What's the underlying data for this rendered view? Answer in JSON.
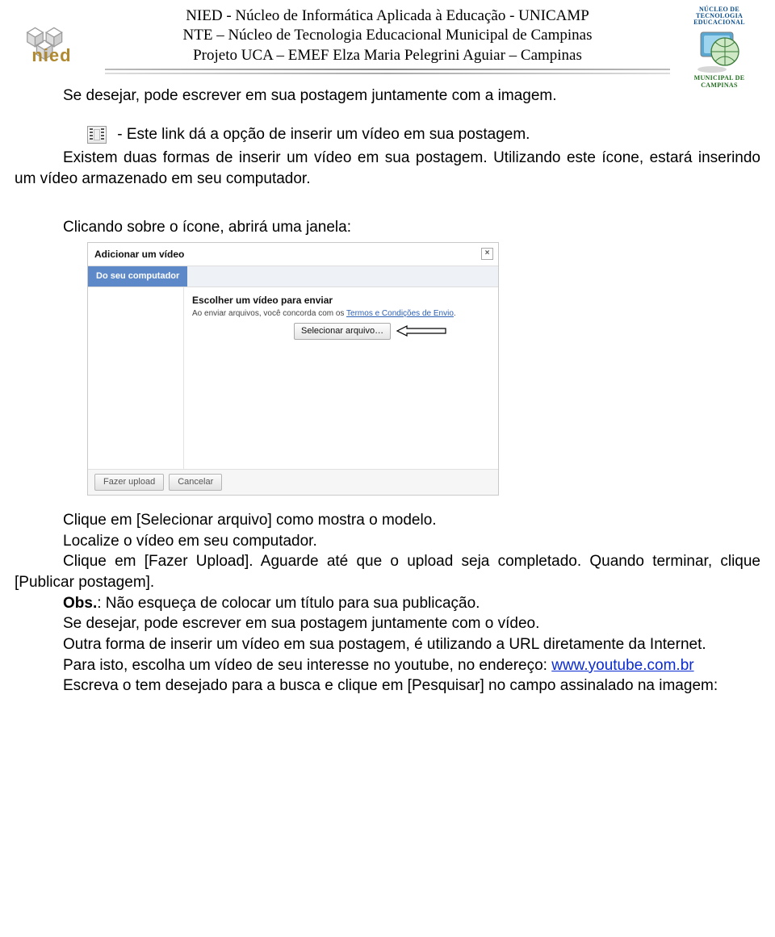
{
  "header": {
    "line1": "NIED - Núcleo de Informática Aplicada à Educação - UNICAMP",
    "line2": "NTE – Núcleo de Tecnologia Educacional Municipal de Campinas",
    "line3": "Projeto UCA – EMEF Elza Maria Pelegrini Aguiar – Campinas",
    "left_logo_text": "nied",
    "right_logo_top": "NÚCLEO DE TECNOLOGIA EDUCACIONAL",
    "right_logo_bottom": "MUNICIPAL DE CAMPINAS"
  },
  "body": {
    "p1": "Se desejar, pode escrever em sua postagem juntamente com a imagem.",
    "p2a": "- Este link dá a opção de inserir um vídeo em sua postagem.",
    "p3": "Existem duas formas de inserir um vídeo em sua postagem. Utilizando este ícone, estará inserindo um vídeo armazenado em seu computador.",
    "p4": "Clicando sobre o ícone, abrirá uma janela:",
    "p5": "Clique em [Selecionar arquivo] como mostra o modelo.",
    "p6": "Localize o vídeo em seu computador.",
    "p7": "Clique em [Fazer Upload]. Aguarde até que o upload seja completado. Quando terminar, clique [Publicar postagem].",
    "p8_label": "Obs.",
    "p8_rest": ": Não esqueça de colocar um título para sua publicação.",
    "p9": "Se desejar, pode escrever em sua postagem juntamente com o vídeo.",
    "p10": "Outra forma de inserir um vídeo em sua postagem, é utilizando a URL diretamente da Internet.",
    "p11": "Para isto, escolha um vídeo de seu interesse no youtube, no endereço:",
    "p11_link": "www.youtube.com.br",
    "p12": "Escreva o tem desejado para a busca e clique em [Pesquisar] no campo assinalado na imagem:"
  },
  "dialog": {
    "title": "Adicionar um vídeo",
    "close": "×",
    "tab1": "Do seu computador",
    "right_title": "Escolher um vídeo para enviar",
    "terms_prefix": "Ao enviar arquivos, você concorda com os ",
    "terms_link": "Termos e Condições de Envio",
    "terms_suffix": ".",
    "file_button": "Selecionar arquivo…",
    "btn_upload": "Fazer upload",
    "btn_cancel": "Cancelar"
  }
}
